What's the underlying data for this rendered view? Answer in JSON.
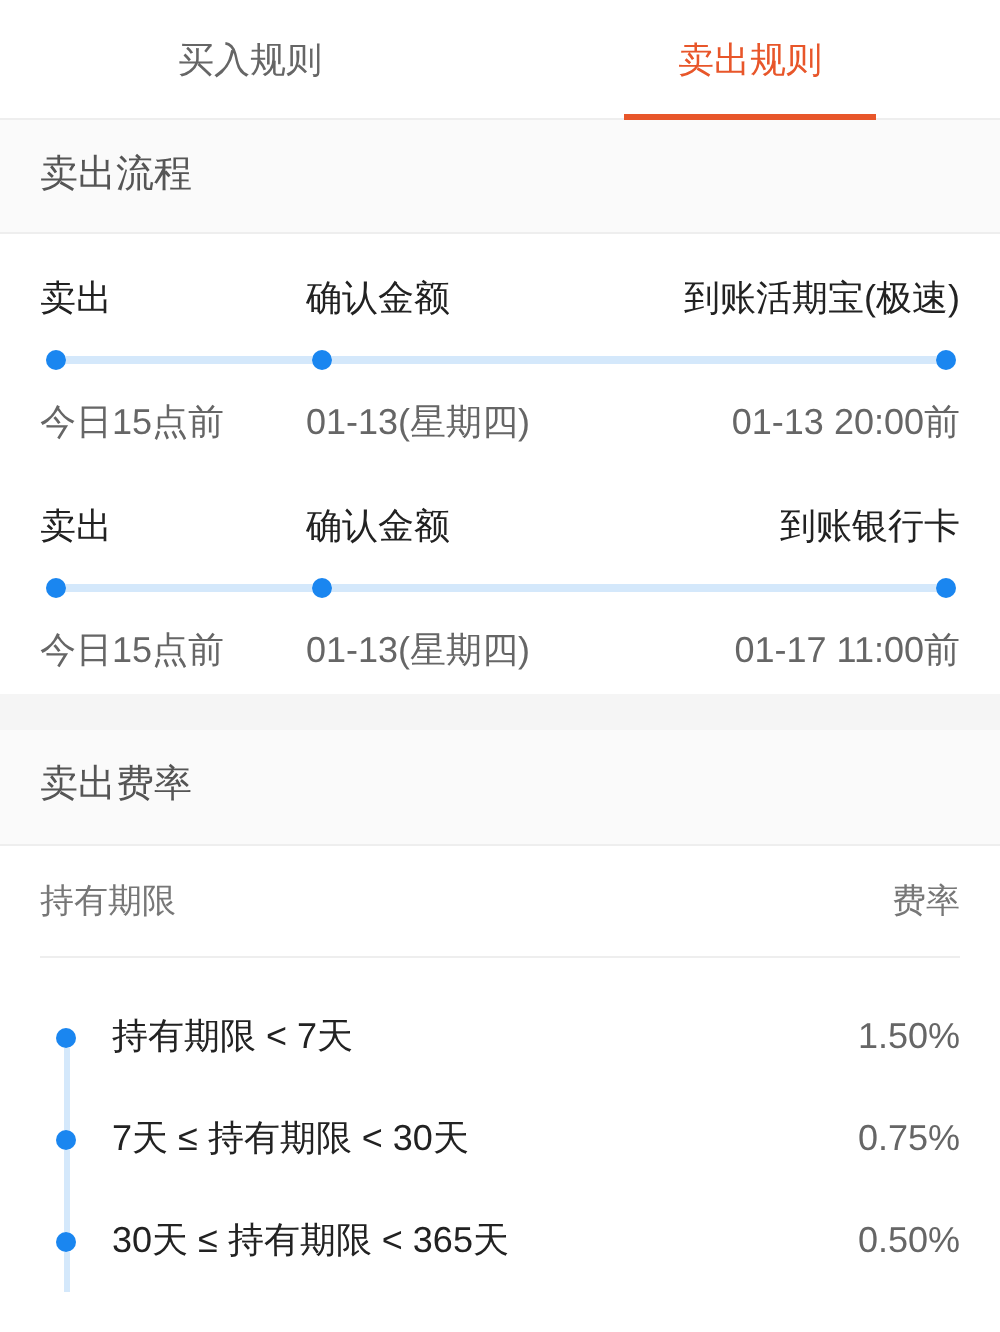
{
  "tabs": [
    {
      "label": "买入规则",
      "selected": false
    },
    {
      "label": "卖出规则",
      "selected": true
    }
  ],
  "sell_flow": {
    "title": "卖出流程",
    "flows": [
      {
        "steps": [
          {
            "label": "卖出",
            "time": "今日15点前"
          },
          {
            "label": "确认金额",
            "time": "01-13(星期四)"
          },
          {
            "label": "到账活期宝(极速)",
            "time": "01-13 20:00前"
          }
        ]
      },
      {
        "steps": [
          {
            "label": "卖出",
            "time": "今日15点前"
          },
          {
            "label": "确认金额",
            "time": "01-13(星期四)"
          },
          {
            "label": "到账银行卡",
            "time": "01-17 11:00前"
          }
        ]
      }
    ]
  },
  "sell_fees": {
    "title": "卖出费率",
    "header": {
      "period": "持有期限",
      "rate": "费率"
    },
    "rows": [
      {
        "period": "持有期限 < 7天",
        "rate": "1.50%"
      },
      {
        "period": "7天 ≤ 持有期限 < 30天",
        "rate": "0.75%"
      },
      {
        "period": "30天 ≤ 持有期限 < 365天",
        "rate": "0.50%"
      }
    ]
  }
}
